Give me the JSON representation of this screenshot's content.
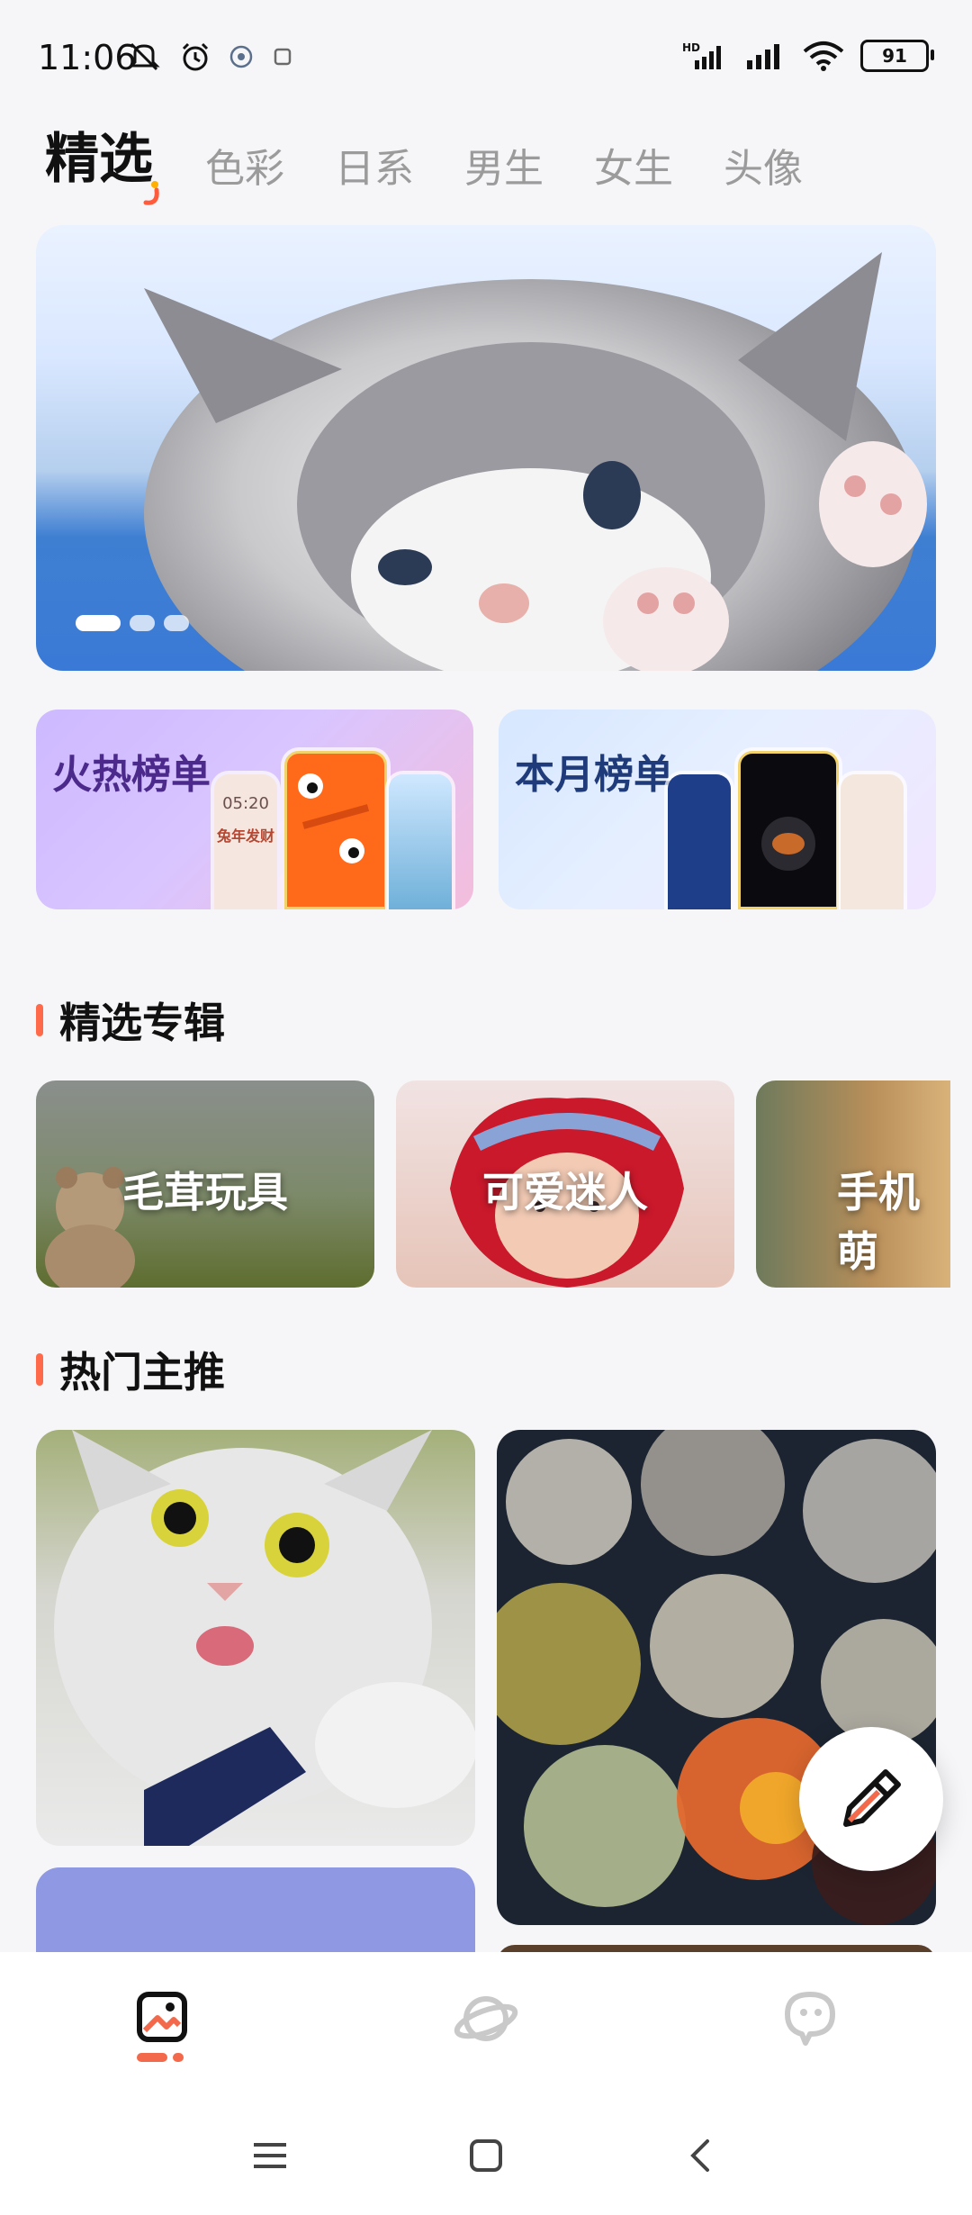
{
  "status_bar": {
    "time": "11:06",
    "battery": "91",
    "icons_left": [
      "mute-icon",
      "alarm-icon",
      "app-notif-icon",
      "app-notif-icon-2"
    ],
    "icons_right": [
      "hd-signal-icon",
      "signal-icon",
      "wifi-icon",
      "battery-icon"
    ]
  },
  "tabs": [
    {
      "label": "精选",
      "active": true
    },
    {
      "label": "色彩",
      "active": false
    },
    {
      "label": "日系",
      "active": false
    },
    {
      "label": "男生",
      "active": false
    },
    {
      "label": "女生",
      "active": false
    },
    {
      "label": "头像",
      "active": false
    }
  ],
  "banner": {
    "pages": 3,
    "active_page": 1
  },
  "rank_cards": [
    {
      "title": "火热榜单",
      "phone_text": "05:20",
      "phone_caption": "兔年发财"
    },
    {
      "title": "本月榜单"
    }
  ],
  "sections": {
    "albums_title": "精选专辑",
    "hot_title": "热门主推"
  },
  "albums": [
    {
      "label": "毛茸玩具"
    },
    {
      "label": "可爱迷人"
    },
    {
      "label": "手机萌"
    }
  ],
  "bottom_nav": [
    {
      "name": "wallpaper-tab",
      "icon": "image-icon",
      "active": true
    },
    {
      "name": "planet-tab",
      "icon": "planet-icon",
      "active": false
    },
    {
      "name": "chat-tab",
      "icon": "chat-bubble-icon",
      "active": false
    }
  ],
  "colors": {
    "accent": "#f26a4b",
    "background": "#f6f6f8"
  }
}
